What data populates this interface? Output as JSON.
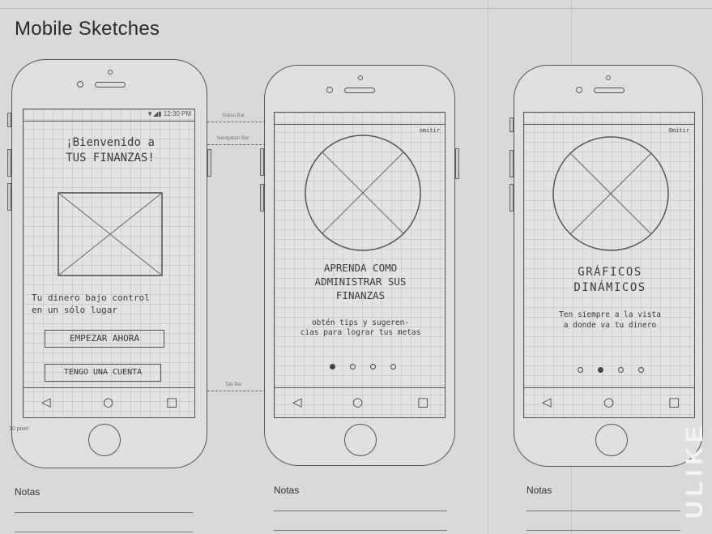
{
  "sheet": {
    "title": "Mobile Sketches",
    "pixel_note": "10 pixel",
    "watermark": "ULIKE"
  },
  "annotations": {
    "status_bar": "Status Bar",
    "navigation_bar": "Navigation Bar",
    "tab_bar": "Tab Bar"
  },
  "phone1": {
    "status_text": "▼◢▮ 12:30 PM",
    "welcome": "¡Bienvenido a\nTUS FINANZAS!",
    "tagline": "Tu dinero bajo control\nen un sólo lugar",
    "start_button": "EMPEZAR AHORA",
    "account_button": "TENGO UNA CUENTA"
  },
  "phone2": {
    "skip": "omitir",
    "heading": "APRENDA COMO\nADMINISTRAR SUS\nFINANZAS",
    "subtext": "obtén tips y sugeren-\ncias para lograr tus metas"
  },
  "phone3": {
    "skip": "Omitir",
    "heading": "GRÁFICOS\nDINÁMICOS",
    "subtext": "Ten siempre a la vista\na donde va tu dinero"
  },
  "navbar_icons": {
    "back": "◁",
    "home": "○",
    "recents": "□"
  },
  "notes": {
    "label": "Notas"
  }
}
